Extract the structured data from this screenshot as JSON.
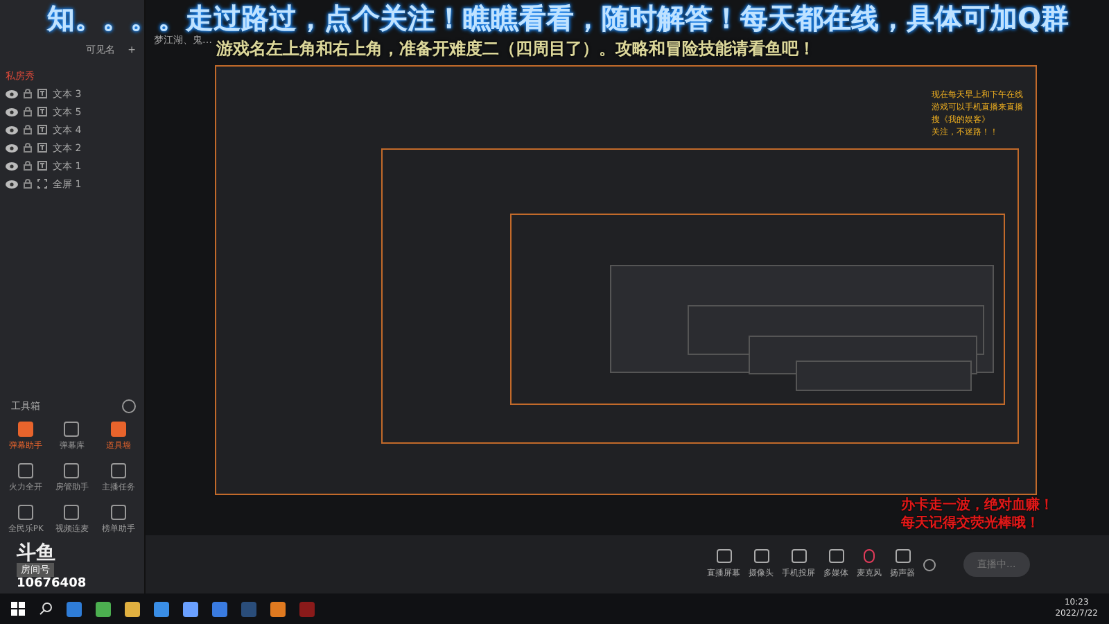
{
  "overlay_banner": {
    "line_1": "知。。。。走过路过，点个关注！瞧瞧看看，随时解答！每天都在线，具体可加Q群",
    "line_2": "游戏名左上角和右上角，准备开难度二（四周目了）。攻略和冒险技能请看鱼吧！"
  },
  "source_panel": {
    "header": "可见名",
    "add": "+",
    "scene_title": "梦江湖、鬼…",
    "sources": [
      {
        "name": "私房秀",
        "kind": "label"
      },
      {
        "name": "文本 3",
        "kind": "text"
      },
      {
        "name": "文本 5",
        "kind": "text"
      },
      {
        "name": "文本 4",
        "kind": "text"
      },
      {
        "name": "文本 2",
        "kind": "text"
      },
      {
        "name": "文本 1",
        "kind": "text"
      },
      {
        "name": "全屏 1",
        "kind": "screen"
      }
    ]
  },
  "toolbox": {
    "title": "工具箱",
    "tools": [
      {
        "label": "弹幕助手",
        "active": true
      },
      {
        "label": "弹幕库",
        "active": false
      },
      {
        "label": "道具墙",
        "active": true
      },
      {
        "label": "火力全开",
        "active": false
      },
      {
        "label": "房管助手",
        "active": false
      },
      {
        "label": "主播任务",
        "active": false
      },
      {
        "label": "全民乐PK",
        "active": false
      },
      {
        "label": "视频连麦",
        "active": false
      },
      {
        "label": "榜单助手",
        "active": false
      }
    ]
  },
  "room": {
    "logo": "斗鱼",
    "label": "房间号",
    "id": "10676408"
  },
  "right_notice": [
    "现在每天早上和下午在线",
    "游戏可以手机直播来直播",
    "搜《我的娱客》",
    "关注，不迷路！！"
  ],
  "bottom_bar": {
    "tools": [
      "直播屏幕",
      "摄像头",
      "手机投屏",
      "多媒体",
      "麦克风",
      "扬声器"
    ],
    "live_button": "直播中..."
  },
  "promo_text": [
    "办卡走一波，绝对血赚！",
    "每天记得交荧光棒哦！"
  ],
  "taskbar": {
    "time": "10:23",
    "date": "2022/7/22"
  }
}
